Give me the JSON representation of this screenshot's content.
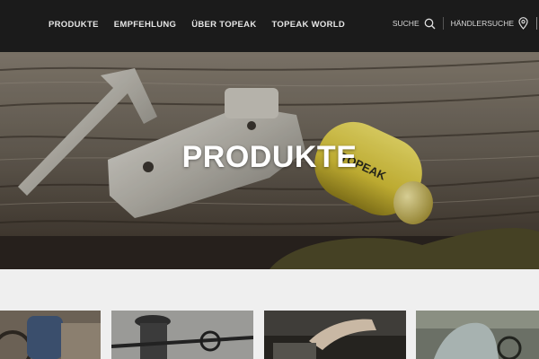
{
  "nav": {
    "items": [
      {
        "label": "PRODUKTE"
      },
      {
        "label": "EMPFEHLUNG"
      },
      {
        "label": "ÜBER TOPEAK"
      },
      {
        "label": "TOPEAK WORLD"
      }
    ]
  },
  "utility": {
    "search_label": "SUCHE",
    "dealer_label": "HÄNDLERSUCHE"
  },
  "hero": {
    "title": "PRODUKTE",
    "brand_text": "TOPEAK"
  },
  "colors": {
    "topbar": "#1b1b1b",
    "page_bg": "#efefef",
    "accent_yellow": "#e4d24a"
  },
  "icons": [
    "search-icon",
    "map-pin-icon"
  ]
}
